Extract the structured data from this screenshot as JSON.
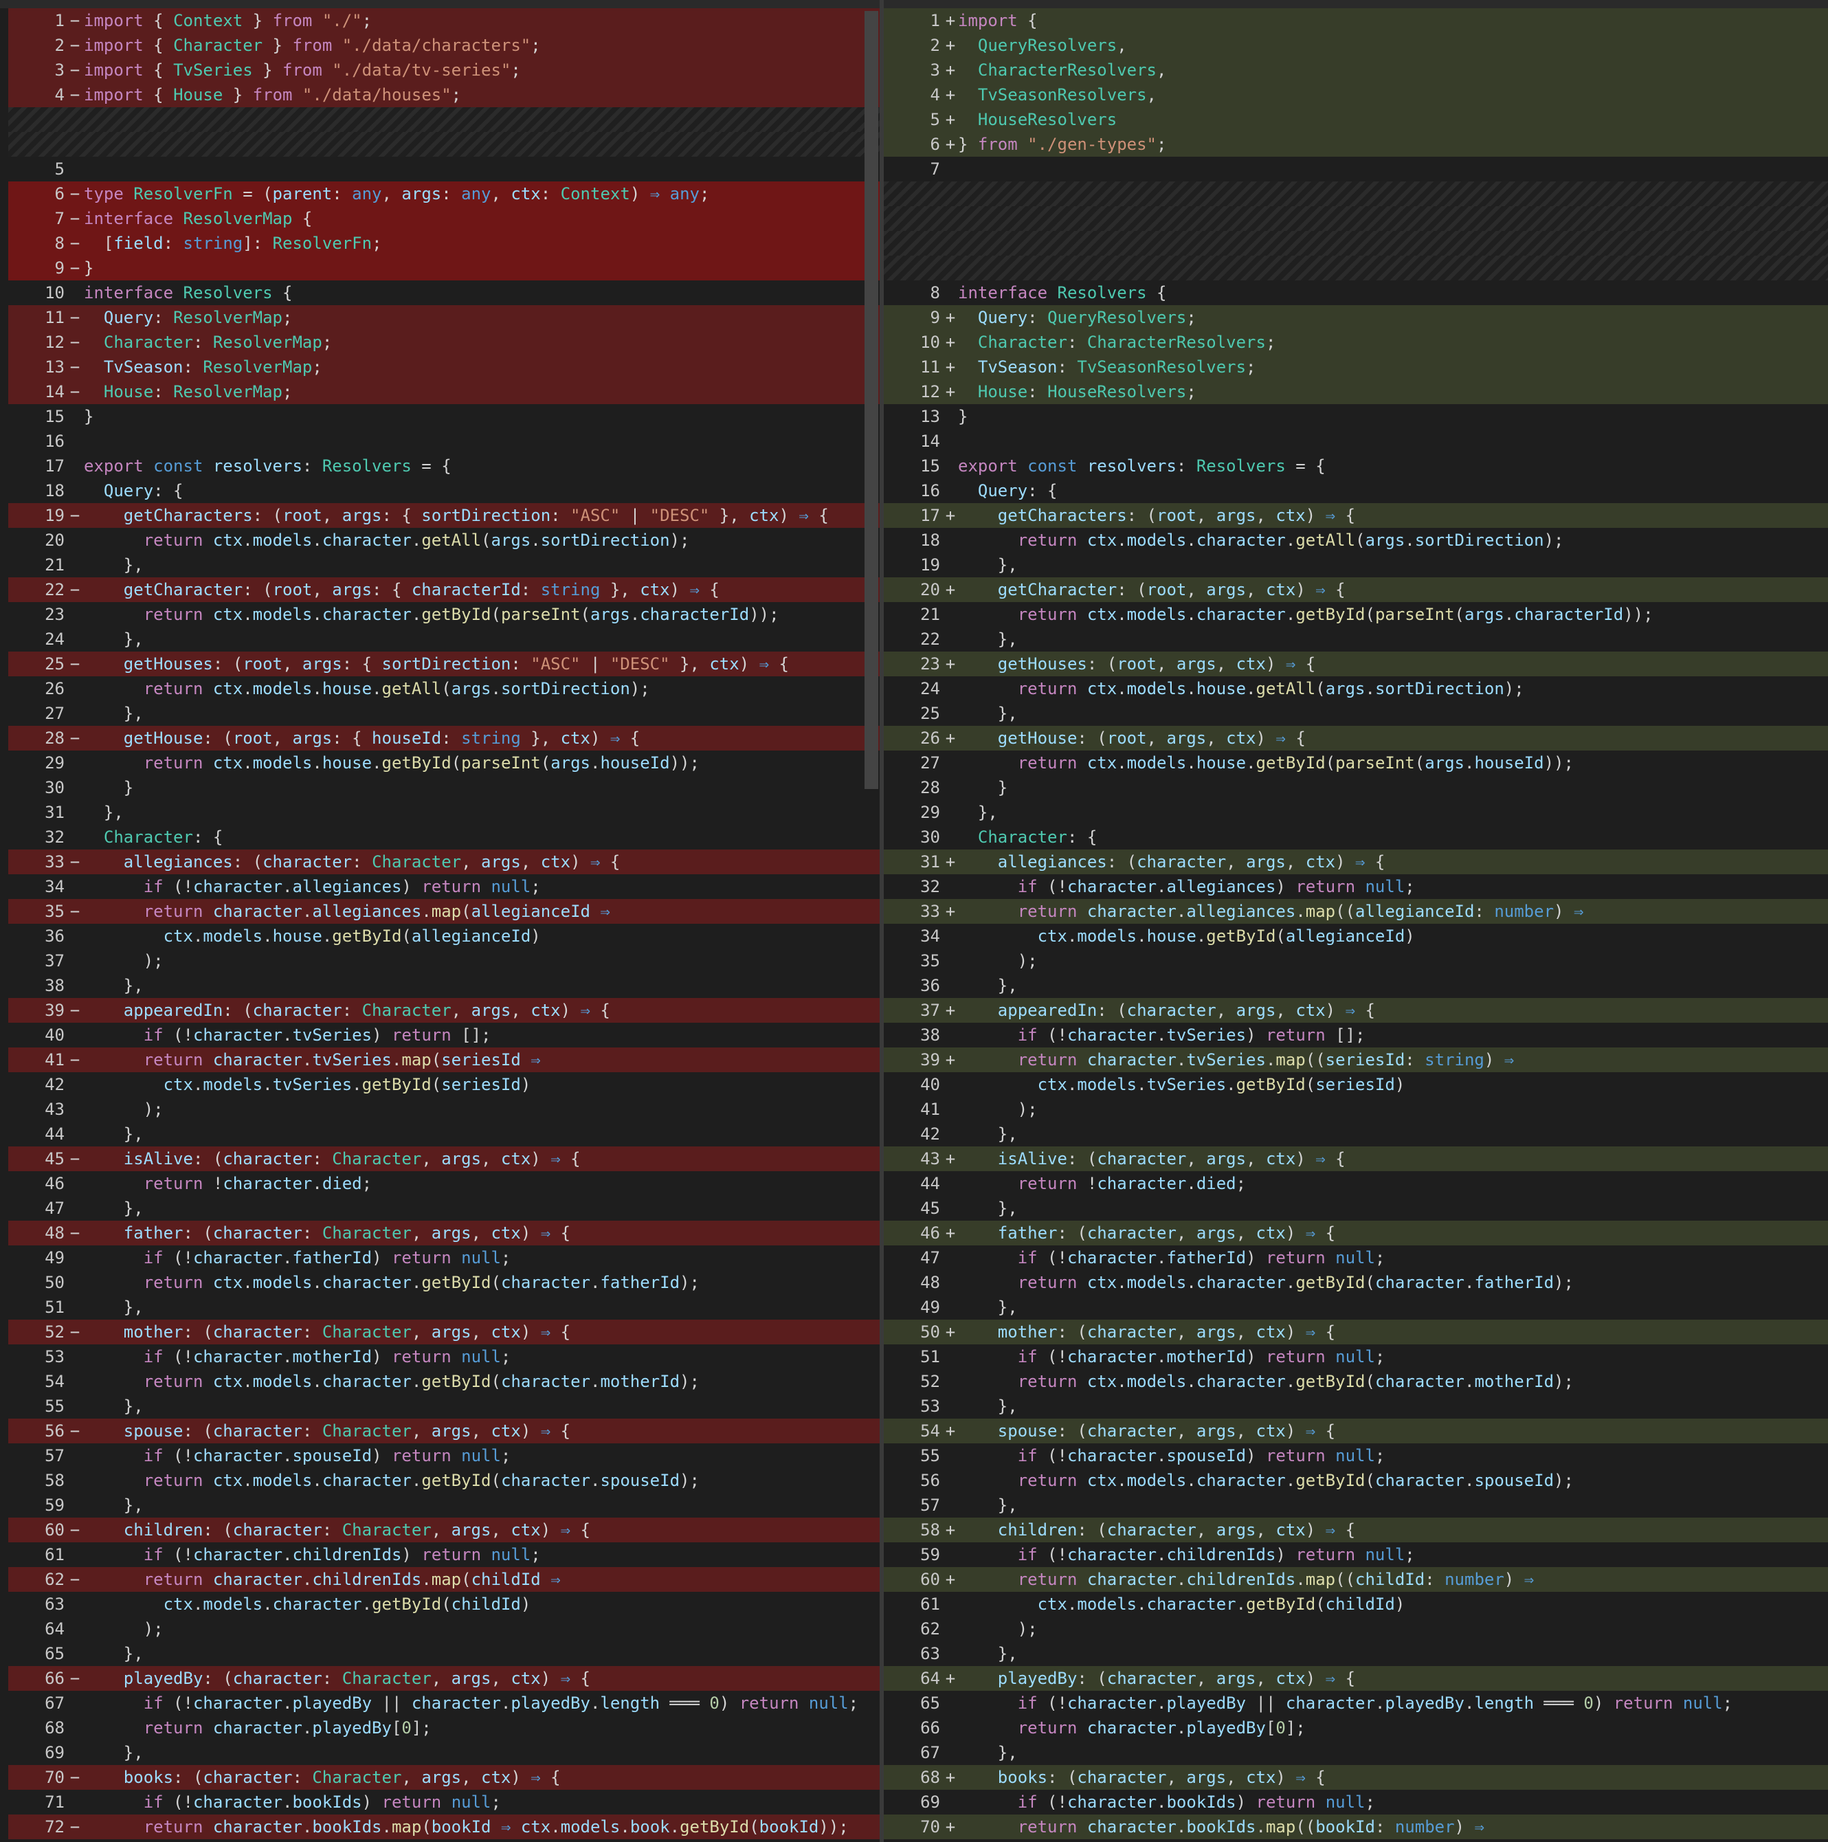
{
  "colors": {
    "background": "#1e1e1e",
    "removed_line": "#5a1d1d",
    "added_line": "#373d29",
    "keyword": "#c586c0",
    "string": "#ce9178",
    "type": "#4ec9b0",
    "function": "#dcdcaa"
  },
  "left": [
    {
      "n": "1",
      "m": "−",
      "t": "del",
      "c": "import { Context } from \"./\";"
    },
    {
      "n": "2",
      "m": "−",
      "t": "del",
      "c": "import { Character } from \"./data/characters\";"
    },
    {
      "n": "3",
      "m": "−",
      "t": "del",
      "c": "import { TvSeries } from \"./data/tv-series\";"
    },
    {
      "n": "4",
      "m": "−",
      "t": "del",
      "c": "import { House } from \"./data/houses\";"
    },
    {
      "n": "",
      "m": "",
      "t": "pad",
      "c": ""
    },
    {
      "n": "",
      "m": "",
      "t": "pad",
      "c": ""
    },
    {
      "n": "5",
      "m": "",
      "t": "ctx",
      "c": ""
    },
    {
      "n": "6",
      "m": "−",
      "t": "delhot",
      "c": "type ResolverFn = (parent: any, args: any, ctx: Context) ⇒ any;"
    },
    {
      "n": "7",
      "m": "−",
      "t": "delhot",
      "c": "interface ResolverMap {"
    },
    {
      "n": "8",
      "m": "−",
      "t": "delhot",
      "c": "  [field: string]: ResolverFn;"
    },
    {
      "n": "9",
      "m": "−",
      "t": "delhot",
      "c": "}"
    },
    {
      "n": "10",
      "m": "",
      "t": "ctx",
      "c": "interface Resolvers {"
    },
    {
      "n": "11",
      "m": "−",
      "t": "del",
      "c": "  Query: ResolverMap;"
    },
    {
      "n": "12",
      "m": "−",
      "t": "del",
      "c": "  Character: ResolverMap;"
    },
    {
      "n": "13",
      "m": "−",
      "t": "del",
      "c": "  TvSeason: ResolverMap;"
    },
    {
      "n": "14",
      "m": "−",
      "t": "del",
      "c": "  House: ResolverMap;"
    },
    {
      "n": "15",
      "m": "",
      "t": "ctx",
      "c": "}"
    },
    {
      "n": "16",
      "m": "",
      "t": "ctx",
      "c": ""
    },
    {
      "n": "17",
      "m": "",
      "t": "ctx",
      "c": "export const resolvers: Resolvers = {"
    },
    {
      "n": "18",
      "m": "",
      "t": "ctx",
      "c": "  Query: {"
    },
    {
      "n": "19",
      "m": "−",
      "t": "del",
      "c": "    getCharacters: (root, args: { sortDirection: \"ASC\" | \"DESC\" }, ctx) ⇒ {"
    },
    {
      "n": "20",
      "m": "",
      "t": "ctx",
      "c": "      return ctx.models.character.getAll(args.sortDirection);"
    },
    {
      "n": "21",
      "m": "",
      "t": "ctx",
      "c": "    },"
    },
    {
      "n": "22",
      "m": "−",
      "t": "del",
      "c": "    getCharacter: (root, args: { characterId: string }, ctx) ⇒ {"
    },
    {
      "n": "23",
      "m": "",
      "t": "ctx",
      "c": "      return ctx.models.character.getById(parseInt(args.characterId));"
    },
    {
      "n": "24",
      "m": "",
      "t": "ctx",
      "c": "    },"
    },
    {
      "n": "25",
      "m": "−",
      "t": "del",
      "c": "    getHouses: (root, args: { sortDirection: \"ASC\" | \"DESC\" }, ctx) ⇒ {"
    },
    {
      "n": "26",
      "m": "",
      "t": "ctx",
      "c": "      return ctx.models.house.getAll(args.sortDirection);"
    },
    {
      "n": "27",
      "m": "",
      "t": "ctx",
      "c": "    },"
    },
    {
      "n": "28",
      "m": "−",
      "t": "del",
      "c": "    getHouse: (root, args: { houseId: string }, ctx) ⇒ {"
    },
    {
      "n": "29",
      "m": "",
      "t": "ctx",
      "c": "      return ctx.models.house.getById(parseInt(args.houseId));"
    },
    {
      "n": "30",
      "m": "",
      "t": "ctx",
      "c": "    }"
    },
    {
      "n": "31",
      "m": "",
      "t": "ctx",
      "c": "  },"
    },
    {
      "n": "32",
      "m": "",
      "t": "ctx",
      "c": "  Character: {"
    },
    {
      "n": "33",
      "m": "−",
      "t": "del",
      "c": "    allegiances: (character: Character, args, ctx) ⇒ {"
    },
    {
      "n": "34",
      "m": "",
      "t": "ctx",
      "c": "      if (!character.allegiances) return null;"
    },
    {
      "n": "35",
      "m": "−",
      "t": "del",
      "c": "      return character.allegiances.map(allegianceId ⇒"
    },
    {
      "n": "36",
      "m": "",
      "t": "ctx",
      "c": "        ctx.models.house.getById(allegianceId)"
    },
    {
      "n": "37",
      "m": "",
      "t": "ctx",
      "c": "      );"
    },
    {
      "n": "38",
      "m": "",
      "t": "ctx",
      "c": "    },"
    },
    {
      "n": "39",
      "m": "−",
      "t": "del",
      "c": "    appearedIn: (character: Character, args, ctx) ⇒ {"
    },
    {
      "n": "40",
      "m": "",
      "t": "ctx",
      "c": "      if (!character.tvSeries) return [];"
    },
    {
      "n": "41",
      "m": "−",
      "t": "del",
      "c": "      return character.tvSeries.map(seriesId ⇒"
    },
    {
      "n": "42",
      "m": "",
      "t": "ctx",
      "c": "        ctx.models.tvSeries.getById(seriesId)"
    },
    {
      "n": "43",
      "m": "",
      "t": "ctx",
      "c": "      );"
    },
    {
      "n": "44",
      "m": "",
      "t": "ctx",
      "c": "    },"
    },
    {
      "n": "45",
      "m": "−",
      "t": "del",
      "c": "    isAlive: (character: Character, args, ctx) ⇒ {"
    },
    {
      "n": "46",
      "m": "",
      "t": "ctx",
      "c": "      return !character.died;"
    },
    {
      "n": "47",
      "m": "",
      "t": "ctx",
      "c": "    },"
    },
    {
      "n": "48",
      "m": "−",
      "t": "del",
      "c": "    father: (character: Character, args, ctx) ⇒ {"
    },
    {
      "n": "49",
      "m": "",
      "t": "ctx",
      "c": "      if (!character.fatherId) return null;"
    },
    {
      "n": "50",
      "m": "",
      "t": "ctx",
      "c": "      return ctx.models.character.getById(character.fatherId);"
    },
    {
      "n": "51",
      "m": "",
      "t": "ctx",
      "c": "    },"
    },
    {
      "n": "52",
      "m": "−",
      "t": "del",
      "c": "    mother: (character: Character, args, ctx) ⇒ {"
    },
    {
      "n": "53",
      "m": "",
      "t": "ctx",
      "c": "      if (!character.motherId) return null;"
    },
    {
      "n": "54",
      "m": "",
      "t": "ctx",
      "c": "      return ctx.models.character.getById(character.motherId);"
    },
    {
      "n": "55",
      "m": "",
      "t": "ctx",
      "c": "    },"
    },
    {
      "n": "56",
      "m": "−",
      "t": "del",
      "c": "    spouse: (character: Character, args, ctx) ⇒ {"
    },
    {
      "n": "57",
      "m": "",
      "t": "ctx",
      "c": "      if (!character.spouseId) return null;"
    },
    {
      "n": "58",
      "m": "",
      "t": "ctx",
      "c": "      return ctx.models.character.getById(character.spouseId);"
    },
    {
      "n": "59",
      "m": "",
      "t": "ctx",
      "c": "    },"
    },
    {
      "n": "60",
      "m": "−",
      "t": "del",
      "c": "    children: (character: Character, args, ctx) ⇒ {"
    },
    {
      "n": "61",
      "m": "",
      "t": "ctx",
      "c": "      if (!character.childrenIds) return null;"
    },
    {
      "n": "62",
      "m": "−",
      "t": "del",
      "c": "      return character.childrenIds.map(childId ⇒"
    },
    {
      "n": "63",
      "m": "",
      "t": "ctx",
      "c": "        ctx.models.character.getById(childId)"
    },
    {
      "n": "64",
      "m": "",
      "t": "ctx",
      "c": "      );"
    },
    {
      "n": "65",
      "m": "",
      "t": "ctx",
      "c": "    },"
    },
    {
      "n": "66",
      "m": "−",
      "t": "del",
      "c": "    playedBy: (character: Character, args, ctx) ⇒ {"
    },
    {
      "n": "67",
      "m": "",
      "t": "ctx",
      "c": "      if (!character.playedBy || character.playedBy.length ═══ 0) return null;"
    },
    {
      "n": "68",
      "m": "",
      "t": "ctx",
      "c": "      return character.playedBy[0];"
    },
    {
      "n": "69",
      "m": "",
      "t": "ctx",
      "c": "    },"
    },
    {
      "n": "70",
      "m": "−",
      "t": "del",
      "c": "    books: (character: Character, args, ctx) ⇒ {"
    },
    {
      "n": "71",
      "m": "",
      "t": "ctx",
      "c": "      if (!character.bookIds) return null;"
    },
    {
      "n": "72",
      "m": "−",
      "t": "del",
      "c": "      return character.bookIds.map(bookId ⇒ ctx.models.book.getById(bookId));"
    }
  ],
  "right": [
    {
      "n": "1",
      "m": "+",
      "t": "add",
      "c": "import {"
    },
    {
      "n": "2",
      "m": "+",
      "t": "add",
      "c": "  QueryResolvers,"
    },
    {
      "n": "3",
      "m": "+",
      "t": "add",
      "c": "  CharacterResolvers,"
    },
    {
      "n": "4",
      "m": "+",
      "t": "add",
      "c": "  TvSeasonResolvers,"
    },
    {
      "n": "5",
      "m": "+",
      "t": "add",
      "c": "  HouseResolvers"
    },
    {
      "n": "6",
      "m": "+",
      "t": "add",
      "c": "} from \"./gen-types\";"
    },
    {
      "n": "7",
      "m": "",
      "t": "ctx",
      "c": ""
    },
    {
      "n": "",
      "m": "",
      "t": "pad",
      "c": ""
    },
    {
      "n": "",
      "m": "",
      "t": "pad",
      "c": ""
    },
    {
      "n": "",
      "m": "",
      "t": "pad",
      "c": ""
    },
    {
      "n": "",
      "m": "",
      "t": "pad",
      "c": ""
    },
    {
      "n": "8",
      "m": "",
      "t": "ctx",
      "c": "interface Resolvers {"
    },
    {
      "n": "9",
      "m": "+",
      "t": "add",
      "c": "  Query: QueryResolvers;"
    },
    {
      "n": "10",
      "m": "+",
      "t": "add",
      "c": "  Character: CharacterResolvers;"
    },
    {
      "n": "11",
      "m": "+",
      "t": "add",
      "c": "  TvSeason: TvSeasonResolvers;"
    },
    {
      "n": "12",
      "m": "+",
      "t": "add",
      "c": "  House: HouseResolvers;"
    },
    {
      "n": "13",
      "m": "",
      "t": "ctx",
      "c": "}"
    },
    {
      "n": "14",
      "m": "",
      "t": "ctx",
      "c": ""
    },
    {
      "n": "15",
      "m": "",
      "t": "ctx",
      "c": "export const resolvers: Resolvers = {"
    },
    {
      "n": "16",
      "m": "",
      "t": "ctx",
      "c": "  Query: {"
    },
    {
      "n": "17",
      "m": "+",
      "t": "add",
      "c": "    getCharacters: (root, args, ctx) ⇒ {"
    },
    {
      "n": "18",
      "m": "",
      "t": "ctx",
      "c": "      return ctx.models.character.getAll(args.sortDirection);"
    },
    {
      "n": "19",
      "m": "",
      "t": "ctx",
      "c": "    },"
    },
    {
      "n": "20",
      "m": "+",
      "t": "add",
      "c": "    getCharacter: (root, args, ctx) ⇒ {"
    },
    {
      "n": "21",
      "m": "",
      "t": "ctx",
      "c": "      return ctx.models.character.getById(parseInt(args.characterId));"
    },
    {
      "n": "22",
      "m": "",
      "t": "ctx",
      "c": "    },"
    },
    {
      "n": "23",
      "m": "+",
      "t": "add",
      "c": "    getHouses: (root, args, ctx) ⇒ {"
    },
    {
      "n": "24",
      "m": "",
      "t": "ctx",
      "c": "      return ctx.models.house.getAll(args.sortDirection);"
    },
    {
      "n": "25",
      "m": "",
      "t": "ctx",
      "c": "    },"
    },
    {
      "n": "26",
      "m": "+",
      "t": "add",
      "c": "    getHouse: (root, args, ctx) ⇒ {"
    },
    {
      "n": "27",
      "m": "",
      "t": "ctx",
      "c": "      return ctx.models.house.getById(parseInt(args.houseId));"
    },
    {
      "n": "28",
      "m": "",
      "t": "ctx",
      "c": "    }"
    },
    {
      "n": "29",
      "m": "",
      "t": "ctx",
      "c": "  },"
    },
    {
      "n": "30",
      "m": "",
      "t": "ctx",
      "c": "  Character: {"
    },
    {
      "n": "31",
      "m": "+",
      "t": "add",
      "c": "    allegiances: (character, args, ctx) ⇒ {"
    },
    {
      "n": "32",
      "m": "",
      "t": "ctx",
      "c": "      if (!character.allegiances) return null;"
    },
    {
      "n": "33",
      "m": "+",
      "t": "add",
      "c": "      return character.allegiances.map((allegianceId: number) ⇒"
    },
    {
      "n": "34",
      "m": "",
      "t": "ctx",
      "c": "        ctx.models.house.getById(allegianceId)"
    },
    {
      "n": "35",
      "m": "",
      "t": "ctx",
      "c": "      );"
    },
    {
      "n": "36",
      "m": "",
      "t": "ctx",
      "c": "    },"
    },
    {
      "n": "37",
      "m": "+",
      "t": "add",
      "c": "    appearedIn: (character, args, ctx) ⇒ {"
    },
    {
      "n": "38",
      "m": "",
      "t": "ctx",
      "c": "      if (!character.tvSeries) return [];"
    },
    {
      "n": "39",
      "m": "+",
      "t": "add",
      "c": "      return character.tvSeries.map((seriesId: string) ⇒"
    },
    {
      "n": "40",
      "m": "",
      "t": "ctx",
      "c": "        ctx.models.tvSeries.getById(seriesId)"
    },
    {
      "n": "41",
      "m": "",
      "t": "ctx",
      "c": "      );"
    },
    {
      "n": "42",
      "m": "",
      "t": "ctx",
      "c": "    },"
    },
    {
      "n": "43",
      "m": "+",
      "t": "add",
      "c": "    isAlive: (character, args, ctx) ⇒ {"
    },
    {
      "n": "44",
      "m": "",
      "t": "ctx",
      "c": "      return !character.died;"
    },
    {
      "n": "45",
      "m": "",
      "t": "ctx",
      "c": "    },"
    },
    {
      "n": "46",
      "m": "+",
      "t": "add",
      "c": "    father: (character, args, ctx) ⇒ {"
    },
    {
      "n": "47",
      "m": "",
      "t": "ctx",
      "c": "      if (!character.fatherId) return null;"
    },
    {
      "n": "48",
      "m": "",
      "t": "ctx",
      "c": "      return ctx.models.character.getById(character.fatherId);"
    },
    {
      "n": "49",
      "m": "",
      "t": "ctx",
      "c": "    },"
    },
    {
      "n": "50",
      "m": "+",
      "t": "add",
      "c": "    mother: (character, args, ctx) ⇒ {"
    },
    {
      "n": "51",
      "m": "",
      "t": "ctx",
      "c": "      if (!character.motherId) return null;"
    },
    {
      "n": "52",
      "m": "",
      "t": "ctx",
      "c": "      return ctx.models.character.getById(character.motherId);"
    },
    {
      "n": "53",
      "m": "",
      "t": "ctx",
      "c": "    },"
    },
    {
      "n": "54",
      "m": "+",
      "t": "add",
      "c": "    spouse: (character, args, ctx) ⇒ {"
    },
    {
      "n": "55",
      "m": "",
      "t": "ctx",
      "c": "      if (!character.spouseId) return null;"
    },
    {
      "n": "56",
      "m": "",
      "t": "ctx",
      "c": "      return ctx.models.character.getById(character.spouseId);"
    },
    {
      "n": "57",
      "m": "",
      "t": "ctx",
      "c": "    },"
    },
    {
      "n": "58",
      "m": "+",
      "t": "add",
      "c": "    children: (character, args, ctx) ⇒ {"
    },
    {
      "n": "59",
      "m": "",
      "t": "ctx",
      "c": "      if (!character.childrenIds) return null;"
    },
    {
      "n": "60",
      "m": "+",
      "t": "add",
      "c": "      return character.childrenIds.map((childId: number) ⇒"
    },
    {
      "n": "61",
      "m": "",
      "t": "ctx",
      "c": "        ctx.models.character.getById(childId)"
    },
    {
      "n": "62",
      "m": "",
      "t": "ctx",
      "c": "      );"
    },
    {
      "n": "63",
      "m": "",
      "t": "ctx",
      "c": "    },"
    },
    {
      "n": "64",
      "m": "+",
      "t": "add",
      "c": "    playedBy: (character, args, ctx) ⇒ {"
    },
    {
      "n": "65",
      "m": "",
      "t": "ctx",
      "c": "      if (!character.playedBy || character.playedBy.length ═══ 0) return null;"
    },
    {
      "n": "66",
      "m": "",
      "t": "ctx",
      "c": "      return character.playedBy[0];"
    },
    {
      "n": "67",
      "m": "",
      "t": "ctx",
      "c": "    },"
    },
    {
      "n": "68",
      "m": "+",
      "t": "add",
      "c": "    books: (character, args, ctx) ⇒ {"
    },
    {
      "n": "69",
      "m": "",
      "t": "ctx",
      "c": "      if (!character.bookIds) return null;"
    },
    {
      "n": "70",
      "m": "+",
      "t": "add",
      "c": "      return character.bookIds.map((bookId: number) ⇒"
    }
  ]
}
